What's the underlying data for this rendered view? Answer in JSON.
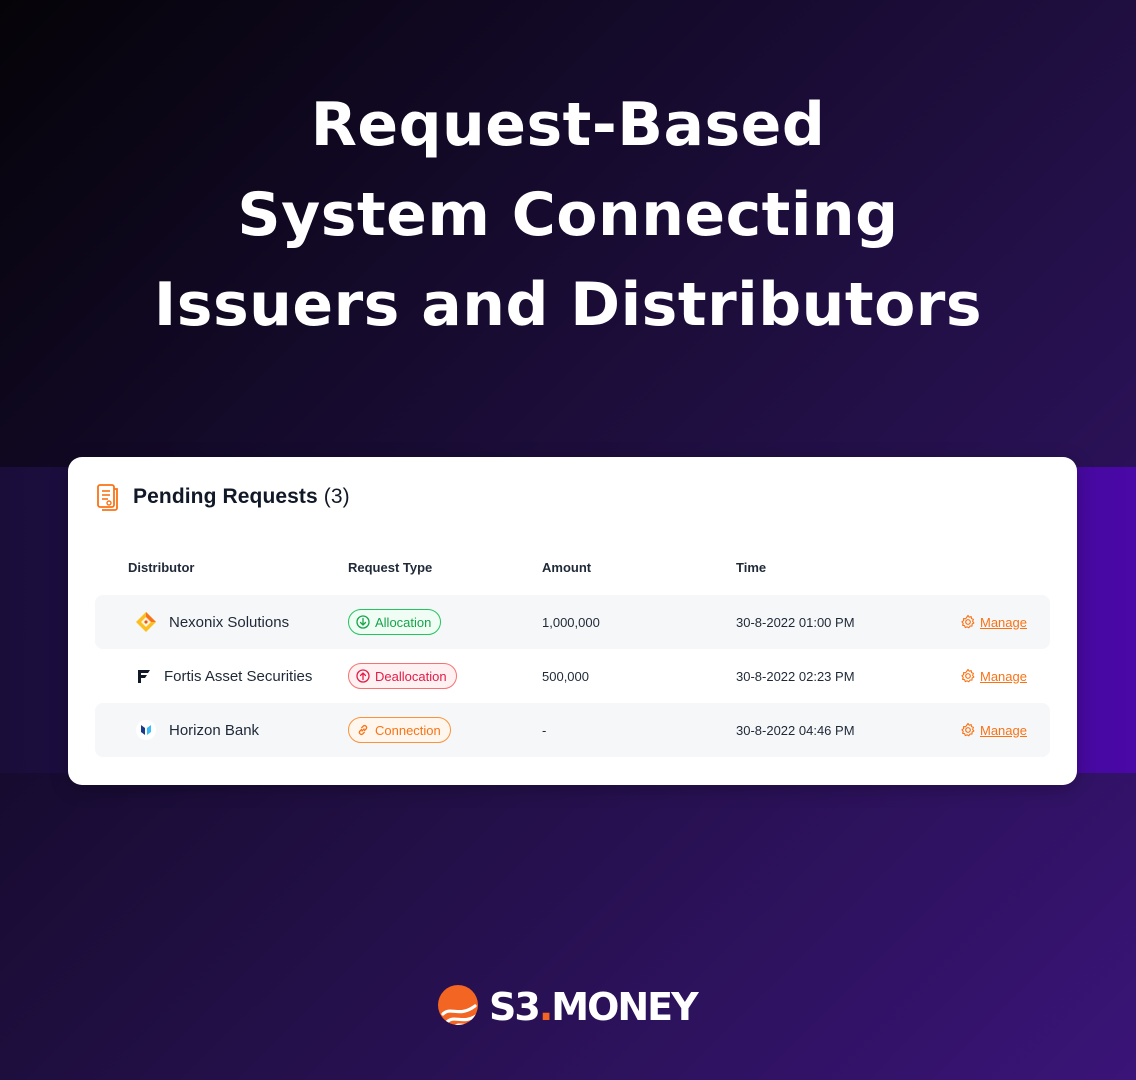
{
  "hero": {
    "line1": "Request-Based",
    "line2": "System Connecting",
    "line3": "Issuers and Distributors"
  },
  "card": {
    "title": "Pending Requests",
    "count": "(3)",
    "columns": [
      "Distributor",
      "Request Type",
      "Amount",
      "Time"
    ],
    "rows": [
      {
        "distributor": "Nexonix Solutions",
        "request_type": "Allocation",
        "amount": "1,000,000",
        "time": "30-8-2022 01:00 PM",
        "action": "Manage"
      },
      {
        "distributor": "Fortis Asset Securities",
        "request_type": "Deallocation",
        "amount": "500,000",
        "time": "30-8-2022 02:23 PM",
        "action": "Manage"
      },
      {
        "distributor": "Horizon Bank",
        "request_type": "Connection",
        "amount": "-",
        "time": "30-8-2022 04:46 PM",
        "action": "Manage"
      }
    ]
  },
  "brand": {
    "name_part1": "S3",
    "dot": ".",
    "name_part2": "MONEY"
  },
  "colors": {
    "accent_orange": "#f97316",
    "allocation_green": "#16a34a",
    "deallocation_red": "#e11d48",
    "background_dark": "#0f0820",
    "background_purple": "#4a08a8"
  },
  "icons": {
    "header": "document-list-icon",
    "allocation": "arrow-down-circle-icon",
    "deallocation": "arrow-up-circle-icon",
    "connection": "link-icon",
    "manage": "gear-icon"
  }
}
